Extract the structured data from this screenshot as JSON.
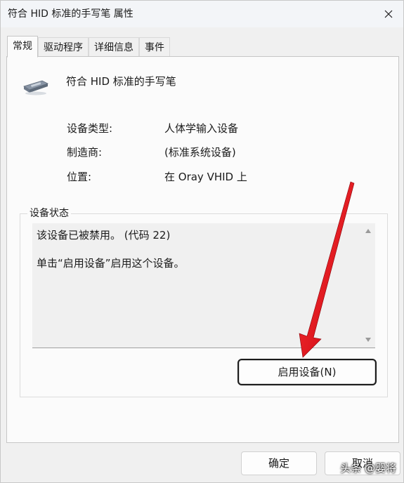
{
  "window": {
    "title": "符合 HID 标准的手写笔 属性"
  },
  "tabs": [
    {
      "label": "常规",
      "active": true
    },
    {
      "label": "驱动程序",
      "active": false
    },
    {
      "label": "详细信息",
      "active": false
    },
    {
      "label": "事件",
      "active": false
    }
  ],
  "device": {
    "icon": "pen-device-icon",
    "name": "符合 HID 标准的手写笔"
  },
  "properties": [
    {
      "label": "设备类型:",
      "value": "人体学输入设备"
    },
    {
      "label": "制造商:",
      "value": "(标准系统设备)"
    },
    {
      "label": "位置:",
      "value": "在 Oray VHID 上"
    }
  ],
  "status_group": {
    "title": "设备状态",
    "lines": [
      "该设备已被禁用。 (代码 22)",
      "单击“启用设备”启用这个设备。"
    ]
  },
  "enable_button": "启用设备(N)",
  "footer": {
    "ok_label": "确定",
    "cancel_label": "取消"
  },
  "watermark": "头条 @婴将",
  "colors": {
    "annotation_arrow": "#e8101a",
    "window_bg": "#f0f0f0",
    "panel_bg": "#fbfbfb"
  }
}
